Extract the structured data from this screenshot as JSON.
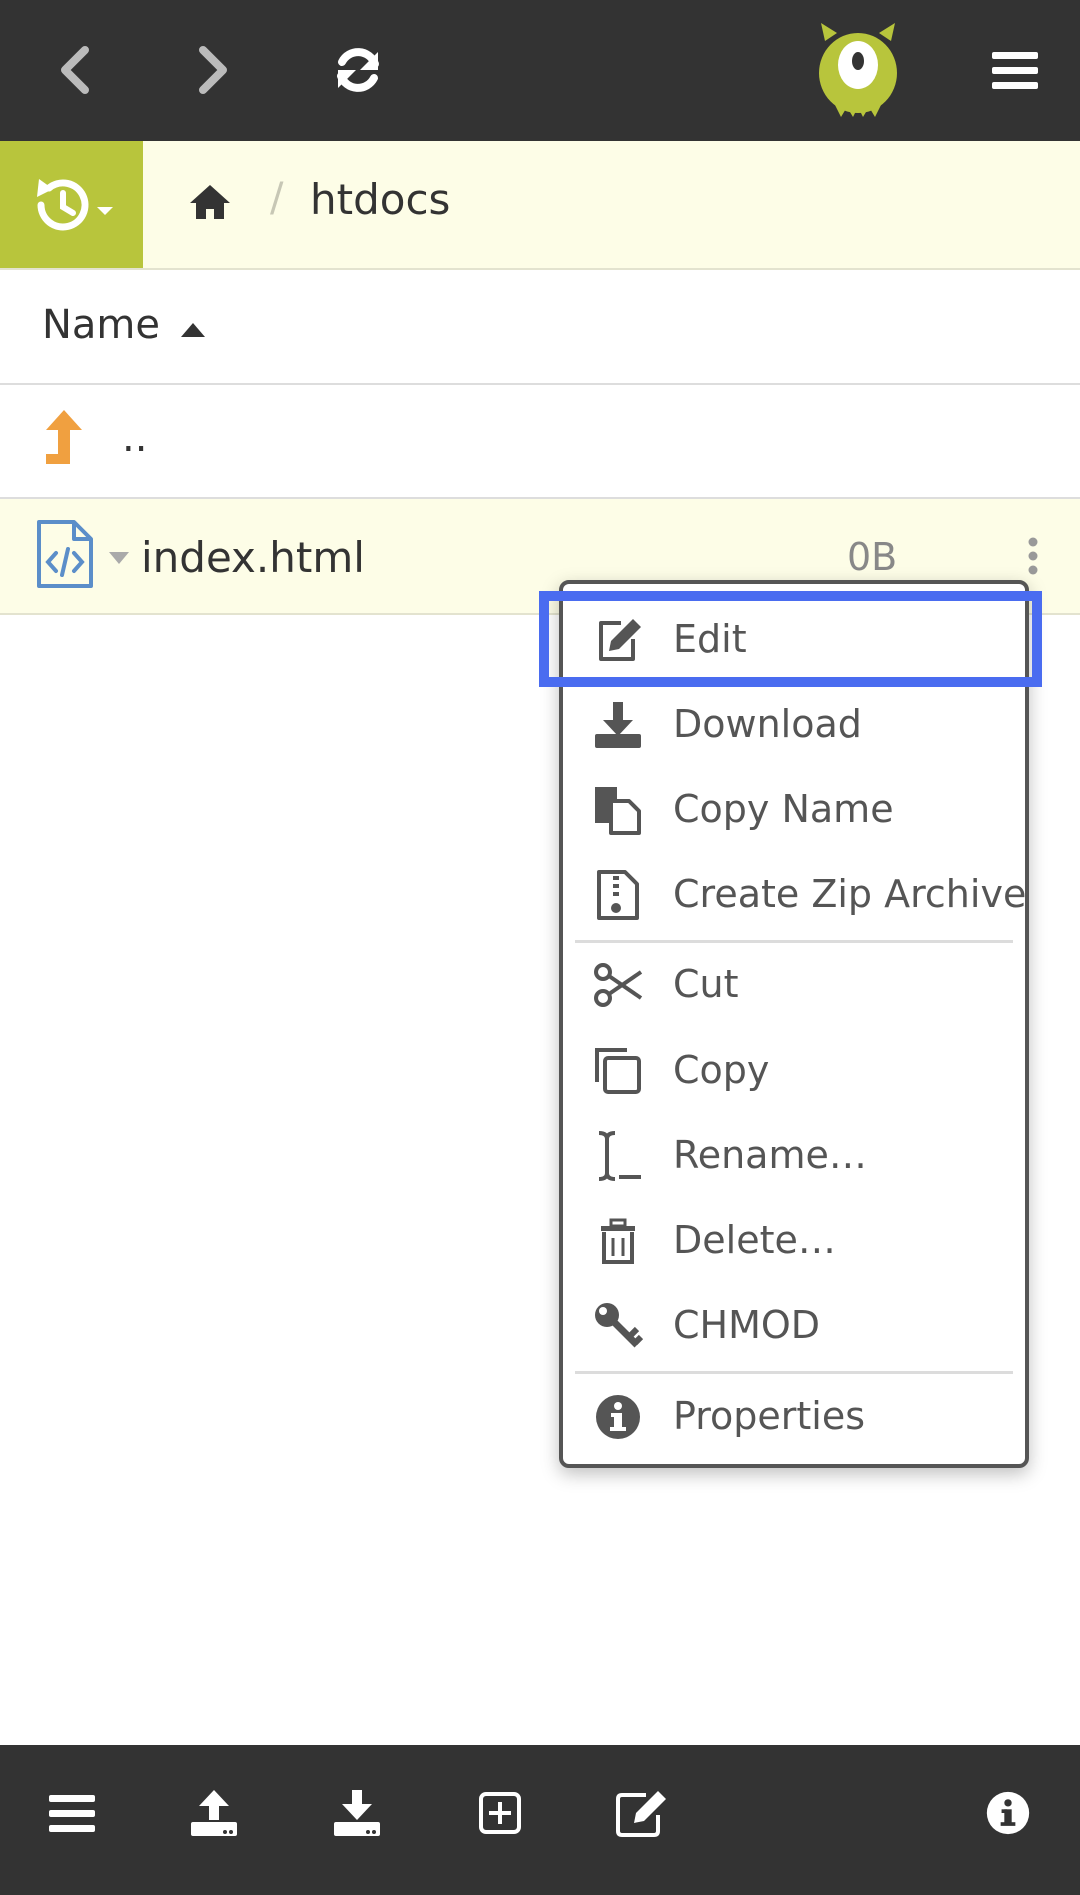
{
  "topbar": {
    "back_icon": "chevron-left-icon",
    "forward_icon": "chevron-right-icon",
    "refresh_icon": "refresh-icon",
    "logo_icon": "monster-logo-icon",
    "menu_icon": "hamburger-icon"
  },
  "breadcrumb": {
    "home_icon": "home-icon",
    "separator": "/",
    "current": "htdocs"
  },
  "list": {
    "name_header": "Name",
    "sort_icon": "sort-asc-icon",
    "up_label": "..",
    "file": {
      "name": "index.html",
      "size": "0B"
    }
  },
  "context_menu": {
    "items": [
      {
        "label": "Edit",
        "icon": "edit-icon"
      },
      {
        "label": "Download",
        "icon": "download-icon"
      },
      {
        "label": "Copy Name",
        "icon": "copy-name-icon"
      },
      {
        "label": "Create Zip Archive",
        "icon": "zip-file-icon"
      },
      {
        "label": "Cut",
        "icon": "scissors-icon"
      },
      {
        "label": "Copy",
        "icon": "copy-icon"
      },
      {
        "label": "Rename…",
        "icon": "text-cursor-icon"
      },
      {
        "label": "Delete…",
        "icon": "trash-icon"
      },
      {
        "label": "CHMOD",
        "icon": "key-icon"
      },
      {
        "label": "Properties",
        "icon": "info-icon"
      }
    ]
  },
  "bottombar": {
    "icons": [
      "list-icon",
      "upload-icon",
      "download-icon",
      "new-item-icon",
      "edit-icon",
      "info-icon"
    ]
  },
  "colors": {
    "dark_bar": "#333333",
    "accent": "#b8c53c",
    "breadcrumb_bg": "#fdfde7",
    "highlight": "#4a6cf0",
    "up_arrow": "#f0a040",
    "file_icon": "#5b8ec9"
  }
}
